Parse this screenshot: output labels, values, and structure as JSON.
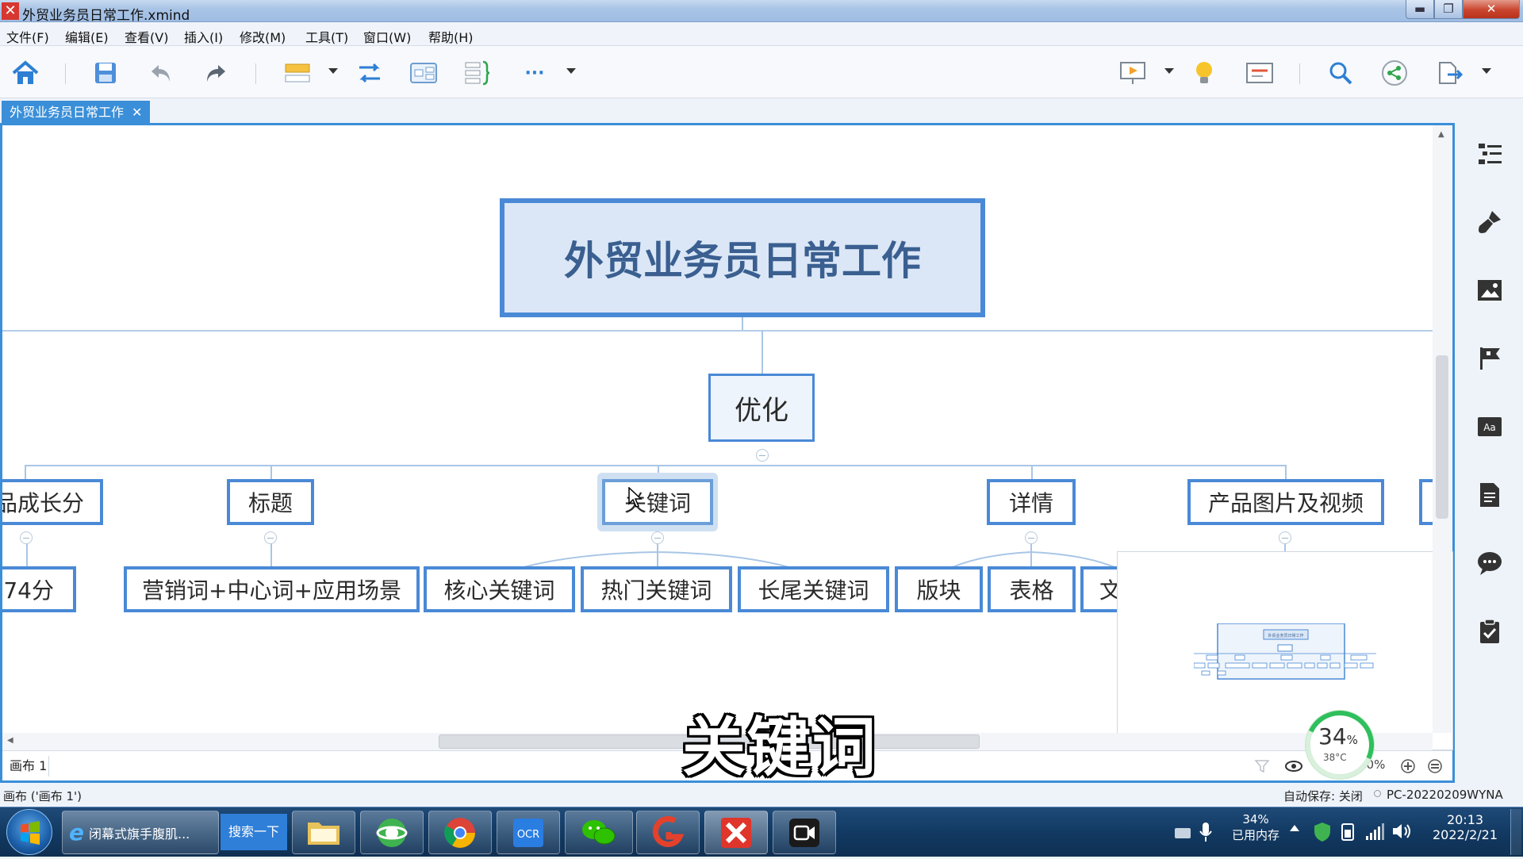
{
  "window": {
    "title": "外贸业务员日常工作.xmind",
    "min": "▬",
    "max": "❐",
    "close": "✕"
  },
  "menu": [
    "文件(F)",
    "编辑(E)",
    "查看(V)",
    "插入(I)",
    "修改(M)",
    "工具(T)",
    "窗口(W)",
    "帮助(H)"
  ],
  "toolbar": {
    "icons": [
      "home-icon",
      "save-icon",
      "undo-icon",
      "redo-icon",
      "topic-icon",
      "relationship-icon",
      "boundary-icon",
      "summary-icon",
      "more-icon",
      "presentation-icon",
      "idea-icon",
      "outline-icon",
      "search-icon",
      "share-icon",
      "export-icon"
    ],
    "more_label": "···"
  },
  "tab": {
    "label": "外贸业务员日常工作",
    "close": "✕"
  },
  "mindmap": {
    "central": "外贸业务员日常工作",
    "main_topic": "优化",
    "subtopics": [
      "品成长分",
      "标题",
      "关键词",
      "详情",
      "产品图片及视频"
    ],
    "leaves": [
      "74分",
      "营销词+中心词+应用场景",
      "核心关键词",
      "热门关键词",
      "长尾关键词",
      "版块",
      "表格",
      "文"
    ],
    "minimap_title": "外贸业务员日常工作"
  },
  "sheet": {
    "tab_label": "画布 1",
    "zoom": "10%"
  },
  "status": {
    "left": "画布 ('画布 1')",
    "autosave": "自动保存: 关闭",
    "pc_name": "PC-20220209WYNA"
  },
  "perf_widget": {
    "percent": "34",
    "percent_sign": "%",
    "temp": "38°C"
  },
  "caption": "关键词",
  "taskbar": {
    "ie_label": "闭幕式旗手腹肌...",
    "search_button": "搜索一下",
    "memory_percent": "34%",
    "memory_label": "已用内存",
    "time": "20:13",
    "date": "2022/2/21"
  },
  "colors": {
    "accent": "#3a8fd8",
    "node_border": "#4a89d6",
    "central_fill": "#dbe7f6",
    "central_text": "#3a5f90"
  }
}
